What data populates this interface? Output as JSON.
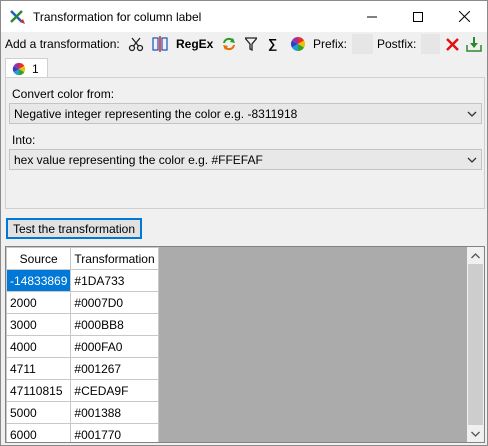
{
  "window": {
    "title": "Transformation for column label"
  },
  "toolbar": {
    "add_label": "Add a transformation:",
    "regex_label": "RegEx",
    "sum_label": "∑",
    "prefix_label": "Prefix:",
    "postfix_label": "Postfix:"
  },
  "tab": {
    "label": "1"
  },
  "panel": {
    "convert_label": "Convert color from:",
    "convert_value": "Negative integer representing the color e.g. -8311918",
    "into_label": "Into:",
    "into_value": "hex value representing the color e.g. #FFEFAF"
  },
  "test_button": {
    "label": "Test the transformation"
  },
  "grid": {
    "headers": [
      "Source",
      "Transformation"
    ],
    "rows": [
      [
        "-14833869",
        "#1DA733"
      ],
      [
        "2000",
        "#0007D0"
      ],
      [
        "3000",
        "#000BB8"
      ],
      [
        "4000",
        "#000FA0"
      ],
      [
        "4711",
        "#001267"
      ],
      [
        "47110815",
        "#CEDA9F"
      ],
      [
        "5000",
        "#001388"
      ],
      [
        "6000",
        "#001770"
      ]
    ],
    "selected_row": 0
  }
}
